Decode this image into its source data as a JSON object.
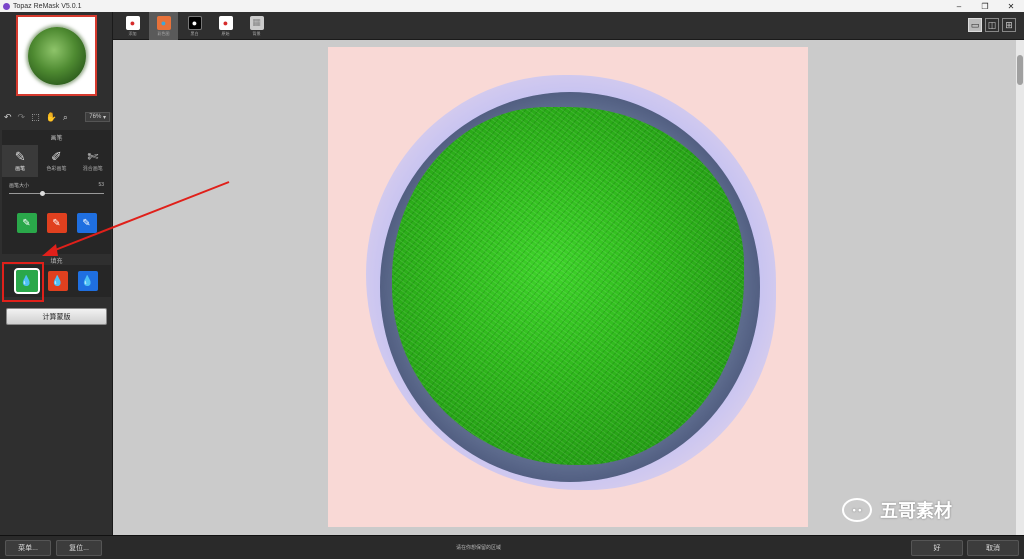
{
  "window": {
    "title": "Topaz ReMask V5.0.1",
    "controls": [
      "–",
      "❐",
      "✕"
    ]
  },
  "sidebar": {
    "zoom": "76%",
    "brush_section_title": "画笔",
    "brush_tools": [
      {
        "label": "画笔",
        "icon": "brush-icon",
        "glyph": "✎"
      },
      {
        "label": "色彩画笔",
        "icon": "color-brush-icon",
        "glyph": "✐"
      },
      {
        "label": "混合画笔",
        "icon": "blend-brush-icon",
        "glyph": "✄"
      }
    ],
    "brush_size_label": "画笔大小",
    "brush_size_value": "53",
    "fill_section_title": "填充",
    "compute_button": "计算蒙版"
  },
  "tabs": [
    {
      "label": "添加"
    },
    {
      "label": "彩色图"
    },
    {
      "label": "黑白"
    },
    {
      "label": "原始"
    },
    {
      "label": "背景"
    }
  ],
  "status_text": "请在你想保留的区域",
  "bottom": {
    "menu_button": "菜单...",
    "reset_button": "复位...",
    "ok_button": "好",
    "cancel_button": "取消"
  },
  "watermark": {
    "text": "五哥素材"
  },
  "colors": {
    "keep_green": "#2aa84a",
    "remove_red": "#e0401f",
    "compute_blue": "#1f6fe0",
    "annotation_red": "#e0201a"
  }
}
